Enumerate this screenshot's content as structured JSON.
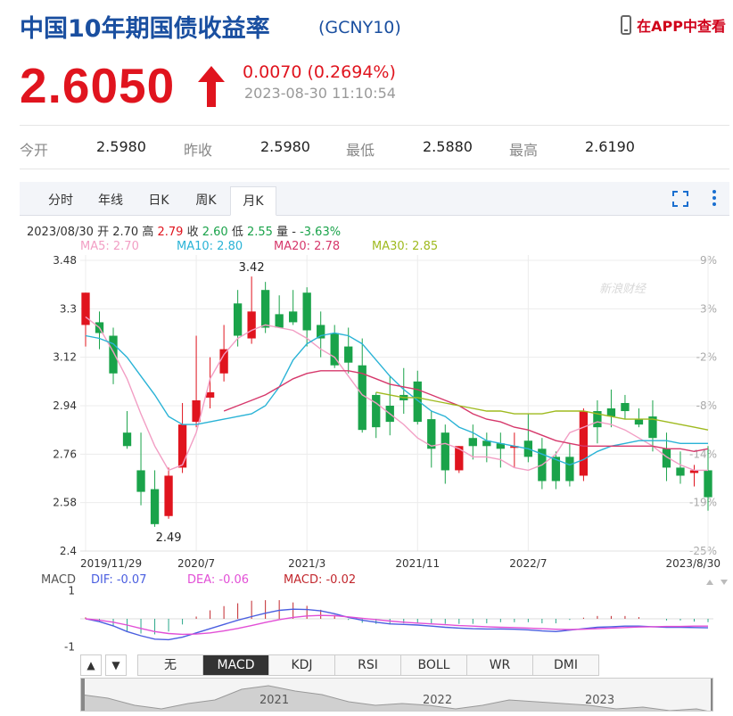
{
  "header": {
    "title": "中国10年期国债收益率",
    "symbol": "(GCNY10)",
    "app_link": "在APP中查看"
  },
  "quote": {
    "price": "2.6050",
    "change": "0.0070 (0.2694%)",
    "time": "2023-08-30 11:10:54",
    "colors": {
      "up": "#e0141e"
    }
  },
  "stats": [
    {
      "label": "今开",
      "value": "2.5980"
    },
    {
      "label": "昨收",
      "value": "2.5980"
    },
    {
      "label": "最低",
      "value": "2.5880"
    },
    {
      "label": "最高",
      "value": "2.6190"
    }
  ],
  "tabs": [
    "分时",
    "年线",
    "日K",
    "周K",
    "月K"
  ],
  "active_tab": "月K",
  "info": {
    "date": "2023/08/30",
    "open_label": "开",
    "open": "2.70",
    "high_label": "高",
    "high": "2.79",
    "close_label": "收",
    "close": "2.60",
    "low_label": "低",
    "low": "2.55",
    "vol_label": "量",
    "vol": "-",
    "pct": "-3.63%"
  },
  "ma": [
    {
      "label": "MA5: 2.70",
      "color": "#f29ec4"
    },
    {
      "label": "MA10: 2.80",
      "color": "#2ab3d6"
    },
    {
      "label": "MA20: 2.78",
      "color": "#d6386b"
    },
    {
      "label": "MA30: 2.85",
      "color": "#9fba1f"
    }
  ],
  "watermark": "新浪财经",
  "macd_legend": {
    "name": "MACD",
    "dif": "DIF: -0.07",
    "dea": "DEA: -0.06",
    "macd": "MACD: -0.02"
  },
  "indicator_tabs": [
    "无",
    "MACD",
    "KDJ",
    "RSI",
    "BOLL",
    "WR",
    "DMI"
  ],
  "active_indicator": "MACD",
  "navigator_years": [
    "2021",
    "2022",
    "2023"
  ],
  "chart_data": {
    "type": "candlestick",
    "y_ticks": [
      "3.48",
      "3.3",
      "3.12",
      "2.94",
      "2.76",
      "2.58",
      "2.4"
    ],
    "pct_ticks": [
      "9%",
      "3%",
      "-2%",
      "-8%",
      "-14%",
      "-19%",
      "-25%"
    ],
    "ylim": [
      2.4,
      3.48
    ],
    "x_ticks": [
      {
        "label": "2019/11/29",
        "index": 0
      },
      {
        "label": "2020/7",
        "index": 8
      },
      {
        "label": "2021/3",
        "index": 16
      },
      {
        "label": "2021/11",
        "index": 24
      },
      {
        "label": "2022/7",
        "index": 32
      },
      {
        "label": "2023/8/30",
        "index": 45
      }
    ],
    "annotations": [
      {
        "text": "3.42",
        "index": 12,
        "value": 3.42
      },
      {
        "text": "2.49",
        "index": 6,
        "value": 2.49
      }
    ],
    "candles": [
      {
        "o": 3.24,
        "h": 3.24,
        "l": 3.16,
        "c": 3.36
      },
      {
        "o": 3.25,
        "h": 3.29,
        "l": 3.15,
        "c": 3.21
      },
      {
        "o": 3.2,
        "h": 3.23,
        "l": 3.02,
        "c": 3.06
      },
      {
        "o": 2.84,
        "h": 2.92,
        "l": 2.78,
        "c": 2.79
      },
      {
        "o": 2.7,
        "h": 2.84,
        "l": 2.57,
        "c": 2.62
      },
      {
        "o": 2.63,
        "h": 2.7,
        "l": 2.49,
        "c": 2.5
      },
      {
        "o": 2.53,
        "h": 2.71,
        "l": 2.52,
        "c": 2.68
      },
      {
        "o": 2.71,
        "h": 2.95,
        "l": 2.69,
        "c": 2.87
      },
      {
        "o": 2.88,
        "h": 3.2,
        "l": 2.86,
        "c": 2.96
      },
      {
        "o": 2.97,
        "h": 3.12,
        "l": 2.93,
        "c": 2.99
      },
      {
        "o": 3.06,
        "h": 3.24,
        "l": 3.03,
        "c": 3.15
      },
      {
        "o": 3.32,
        "h": 3.37,
        "l": 3.16,
        "c": 3.2
      },
      {
        "o": 3.19,
        "h": 3.42,
        "l": 3.17,
        "c": 3.29
      },
      {
        "o": 3.37,
        "h": 3.4,
        "l": 3.21,
        "c": 3.23
      },
      {
        "o": 3.28,
        "h": 3.35,
        "l": 3.25,
        "c": 3.23
      },
      {
        "o": 3.29,
        "h": 3.37,
        "l": 3.24,
        "c": 3.25
      },
      {
        "o": 3.36,
        "h": 3.38,
        "l": 3.16,
        "c": 3.22
      },
      {
        "o": 3.24,
        "h": 3.29,
        "l": 3.12,
        "c": 3.19
      },
      {
        "o": 3.21,
        "h": 3.24,
        "l": 3.08,
        "c": 3.09
      },
      {
        "o": 3.16,
        "h": 3.23,
        "l": 3.06,
        "c": 3.1
      },
      {
        "o": 3.09,
        "h": 3.19,
        "l": 2.84,
        "c": 2.85
      },
      {
        "o": 2.98,
        "h": 2.99,
        "l": 2.82,
        "c": 2.86
      },
      {
        "o": 2.94,
        "h": 3.05,
        "l": 2.83,
        "c": 2.88
      },
      {
        "o": 2.98,
        "h": 3.08,
        "l": 2.91,
        "c": 2.96
      },
      {
        "o": 3.03,
        "h": 3.07,
        "l": 2.87,
        "c": 2.88
      },
      {
        "o": 2.89,
        "h": 2.92,
        "l": 2.71,
        "c": 2.78
      },
      {
        "o": 2.84,
        "h": 2.87,
        "l": 2.65,
        "c": 2.7
      },
      {
        "o": 2.7,
        "h": 2.79,
        "l": 2.69,
        "c": 2.79
      },
      {
        "o": 2.82,
        "h": 2.87,
        "l": 2.74,
        "c": 2.79
      },
      {
        "o": 2.81,
        "h": 2.84,
        "l": 2.73,
        "c": 2.79
      },
      {
        "o": 2.8,
        "h": 2.84,
        "l": 2.71,
        "c": 2.78
      },
      {
        "o": 2.79,
        "h": 2.84,
        "l": 2.71,
        "c": 2.79
      },
      {
        "o": 2.81,
        "h": 2.91,
        "l": 2.73,
        "c": 2.75
      },
      {
        "o": 2.78,
        "h": 2.82,
        "l": 2.63,
        "c": 2.66
      },
      {
        "o": 2.75,
        "h": 2.77,
        "l": 2.63,
        "c": 2.66
      },
      {
        "o": 2.75,
        "h": 2.8,
        "l": 2.64,
        "c": 2.66
      },
      {
        "o": 2.68,
        "h": 2.93,
        "l": 2.66,
        "c": 2.92
      },
      {
        "o": 2.92,
        "h": 2.96,
        "l": 2.8,
        "c": 2.86
      },
      {
        "o": 2.93,
        "h": 3.0,
        "l": 2.86,
        "c": 2.9
      },
      {
        "o": 2.95,
        "h": 2.98,
        "l": 2.89,
        "c": 2.92
      },
      {
        "o": 2.89,
        "h": 2.93,
        "l": 2.86,
        "c": 2.87
      },
      {
        "o": 2.9,
        "h": 2.96,
        "l": 2.77,
        "c": 2.82
      },
      {
        "o": 2.78,
        "h": 2.84,
        "l": 2.66,
        "c": 2.71
      },
      {
        "o": 2.71,
        "h": 2.77,
        "l": 2.65,
        "c": 2.68
      },
      {
        "o": 2.69,
        "h": 2.72,
        "l": 2.64,
        "c": 2.7
      },
      {
        "o": 2.7,
        "h": 2.79,
        "l": 2.55,
        "c": 2.6
      }
    ],
    "ma_series": {
      "ma5": [
        3.27,
        3.23,
        3.14,
        3.04,
        2.91,
        2.79,
        2.7,
        2.72,
        2.84,
        3.04,
        3.13,
        3.19,
        3.22,
        3.24,
        3.23,
        3.22,
        3.19,
        3.15,
        3.12,
        3.05,
        2.98,
        2.95,
        2.91,
        2.87,
        2.82,
        2.79,
        2.8,
        2.78,
        2.75,
        2.75,
        2.74,
        2.71,
        2.7,
        2.72,
        2.76,
        2.84,
        2.86,
        2.88,
        2.87,
        2.85,
        2.82,
        2.79,
        2.75,
        2.72,
        2.7,
        2.7
      ],
      "ma10": [
        3.2,
        3.19,
        3.17,
        3.12,
        3.05,
        2.98,
        2.9,
        2.87,
        2.87,
        2.88,
        2.89,
        2.9,
        2.91,
        2.94,
        3.01,
        3.11,
        3.17,
        3.2,
        3.21,
        3.2,
        3.17,
        3.11,
        3.05,
        3.0,
        2.96,
        2.92,
        2.9,
        2.86,
        2.84,
        2.81,
        2.8,
        2.79,
        2.78,
        2.76,
        2.74,
        2.72,
        2.74,
        2.77,
        2.79,
        2.8,
        2.81,
        2.81,
        2.81,
        2.8,
        2.8,
        2.8
      ],
      "ma20": [
        null,
        null,
        null,
        null,
        null,
        null,
        null,
        null,
        null,
        null,
        2.92,
        2.94,
        2.96,
        2.98,
        3.01,
        3.04,
        3.06,
        3.07,
        3.07,
        3.07,
        3.06,
        3.04,
        3.02,
        3.01,
        3.0,
        2.98,
        2.96,
        2.94,
        2.91,
        2.89,
        2.88,
        2.86,
        2.85,
        2.83,
        2.81,
        2.8,
        2.79,
        2.79,
        2.79,
        2.79,
        2.79,
        2.79,
        2.78,
        2.78,
        2.77,
        2.78
      ],
      "ma30": [
        null,
        null,
        null,
        null,
        null,
        null,
        null,
        null,
        null,
        null,
        null,
        null,
        null,
        null,
        null,
        null,
        null,
        null,
        null,
        null,
        null,
        2.99,
        2.98,
        2.97,
        2.97,
        2.96,
        2.95,
        2.94,
        2.93,
        2.92,
        2.92,
        2.91,
        2.91,
        2.91,
        2.92,
        2.92,
        2.92,
        2.91,
        2.9,
        2.89,
        2.89,
        2.89,
        2.88,
        2.87,
        2.86,
        2.85
      ]
    },
    "macd": {
      "ylim": [
        -1.2,
        1.2
      ],
      "y_ticks": [
        "1",
        "-1"
      ],
      "dif": [
        0.0,
        -0.1,
        -0.25,
        -0.45,
        -0.6,
        -0.72,
        -0.74,
        -0.65,
        -0.5,
        -0.35,
        -0.2,
        -0.05,
        0.08,
        0.2,
        0.3,
        0.34,
        0.33,
        0.28,
        0.18,
        0.05,
        -0.05,
        -0.12,
        -0.18,
        -0.2,
        -0.22,
        -0.26,
        -0.3,
        -0.33,
        -0.35,
        -0.36,
        -0.36,
        -0.37,
        -0.39,
        -0.43,
        -0.45,
        -0.4,
        -0.35,
        -0.3,
        -0.28,
        -0.26,
        -0.26,
        -0.28,
        -0.3,
        -0.3,
        -0.31,
        -0.32
      ],
      "dea": [
        0.0,
        -0.05,
        -0.12,
        -0.22,
        -0.34,
        -0.45,
        -0.52,
        -0.55,
        -0.54,
        -0.5,
        -0.43,
        -0.34,
        -0.24,
        -0.13,
        -0.03,
        0.05,
        0.1,
        0.12,
        0.11,
        0.07,
        0.02,
        -0.03,
        -0.08,
        -0.12,
        -0.15,
        -0.18,
        -0.21,
        -0.24,
        -0.26,
        -0.28,
        -0.3,
        -0.31,
        -0.33,
        -0.35,
        -0.37,
        -0.38,
        -0.37,
        -0.35,
        -0.33,
        -0.31,
        -0.29,
        -0.28,
        -0.27,
        -0.27,
        -0.26,
        -0.26
      ],
      "hist": [
        0.05,
        -0.1,
        -0.25,
        -0.45,
        -0.52,
        -0.55,
        -0.45,
        -0.2,
        0.08,
        0.3,
        0.45,
        0.55,
        0.64,
        0.66,
        0.66,
        0.58,
        0.46,
        0.32,
        0.14,
        -0.04,
        -0.14,
        -0.18,
        -0.2,
        -0.16,
        -0.14,
        -0.16,
        -0.18,
        -0.18,
        -0.18,
        -0.16,
        -0.12,
        -0.12,
        -0.12,
        -0.16,
        -0.16,
        -0.04,
        0.04,
        0.1,
        0.1,
        0.1,
        0.06,
        0.0,
        -0.06,
        -0.06,
        -0.1,
        -0.12
      ]
    }
  }
}
